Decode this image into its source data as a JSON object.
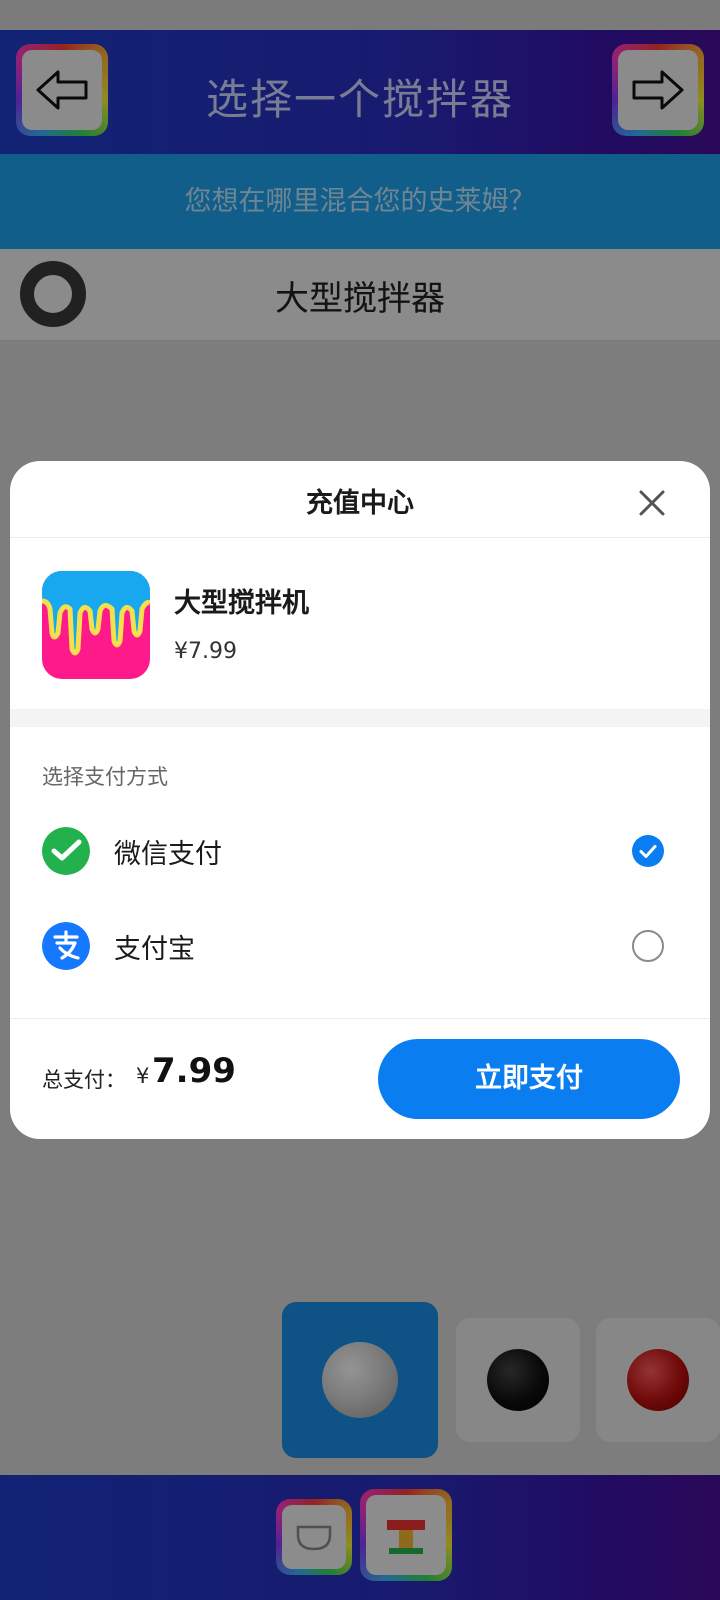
{
  "header": {
    "title": "选择一个搅拌器",
    "subtitle": "您想在哪里混合您的史莱姆？"
  },
  "list": {
    "selected_row_label": "大型搅拌器"
  },
  "modal": {
    "title": "充值中心",
    "product": {
      "name": "大型搅拌机",
      "price": "¥7.99"
    },
    "payment_section_label": "选择支付方式",
    "payment_methods": [
      {
        "label": "微信支付",
        "selected": true
      },
      {
        "label": "支付宝",
        "selected": false
      }
    ],
    "total_label": "总支付：",
    "total_currency": "¥",
    "total_amount": "7.99",
    "pay_button_label": "立即支付"
  },
  "colors": {
    "accent": "#0a7ef0",
    "header_blue": "#2a2fc0",
    "subheader_blue": "#1da3ec",
    "wechat_green": "#22b14c",
    "alipay_blue": "#1677ff",
    "slime_pink": "#ff1a8c"
  },
  "icons": {
    "back": "arrow-left-icon",
    "forward": "arrow-right-icon",
    "close": "close-icon",
    "wechat": "wechat-pay-icon",
    "alipay": "alipay-icon",
    "check": "checkmark-icon"
  }
}
